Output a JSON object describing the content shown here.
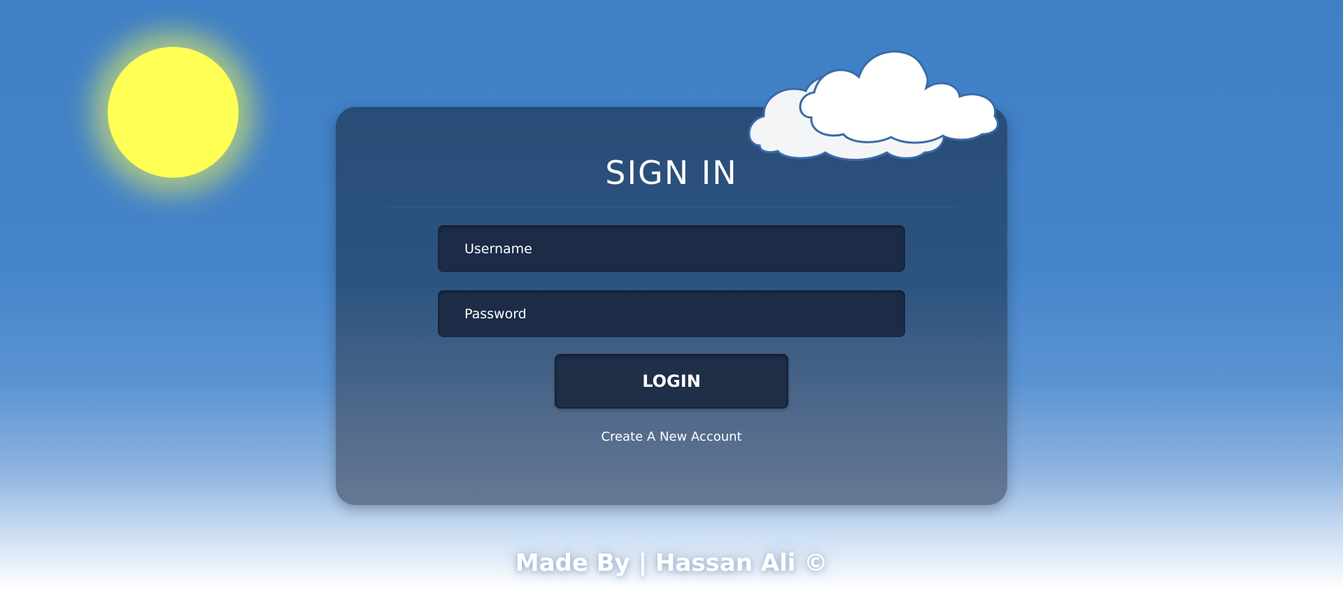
{
  "login_form": {
    "title": "SIGN IN",
    "username": {
      "placeholder": "Username",
      "value": ""
    },
    "password": {
      "placeholder": "Password",
      "value": ""
    },
    "login_label": "LOGIN",
    "create_account_label": "Create A New Account"
  },
  "footer": {
    "credit": "Made By | Hassan Ali ©"
  },
  "scene": {
    "sun_icon": "sun-icon",
    "cloud_icon": "cloud-icon"
  },
  "colors": {
    "sky_top": "#3f7fc6",
    "sky_bottom": "#ffffff",
    "sun": "#ffff55",
    "card": "#2a4f78",
    "input_bg": "#1c2c47",
    "button_bg": "#1f2f48",
    "text": "#ffffff"
  }
}
